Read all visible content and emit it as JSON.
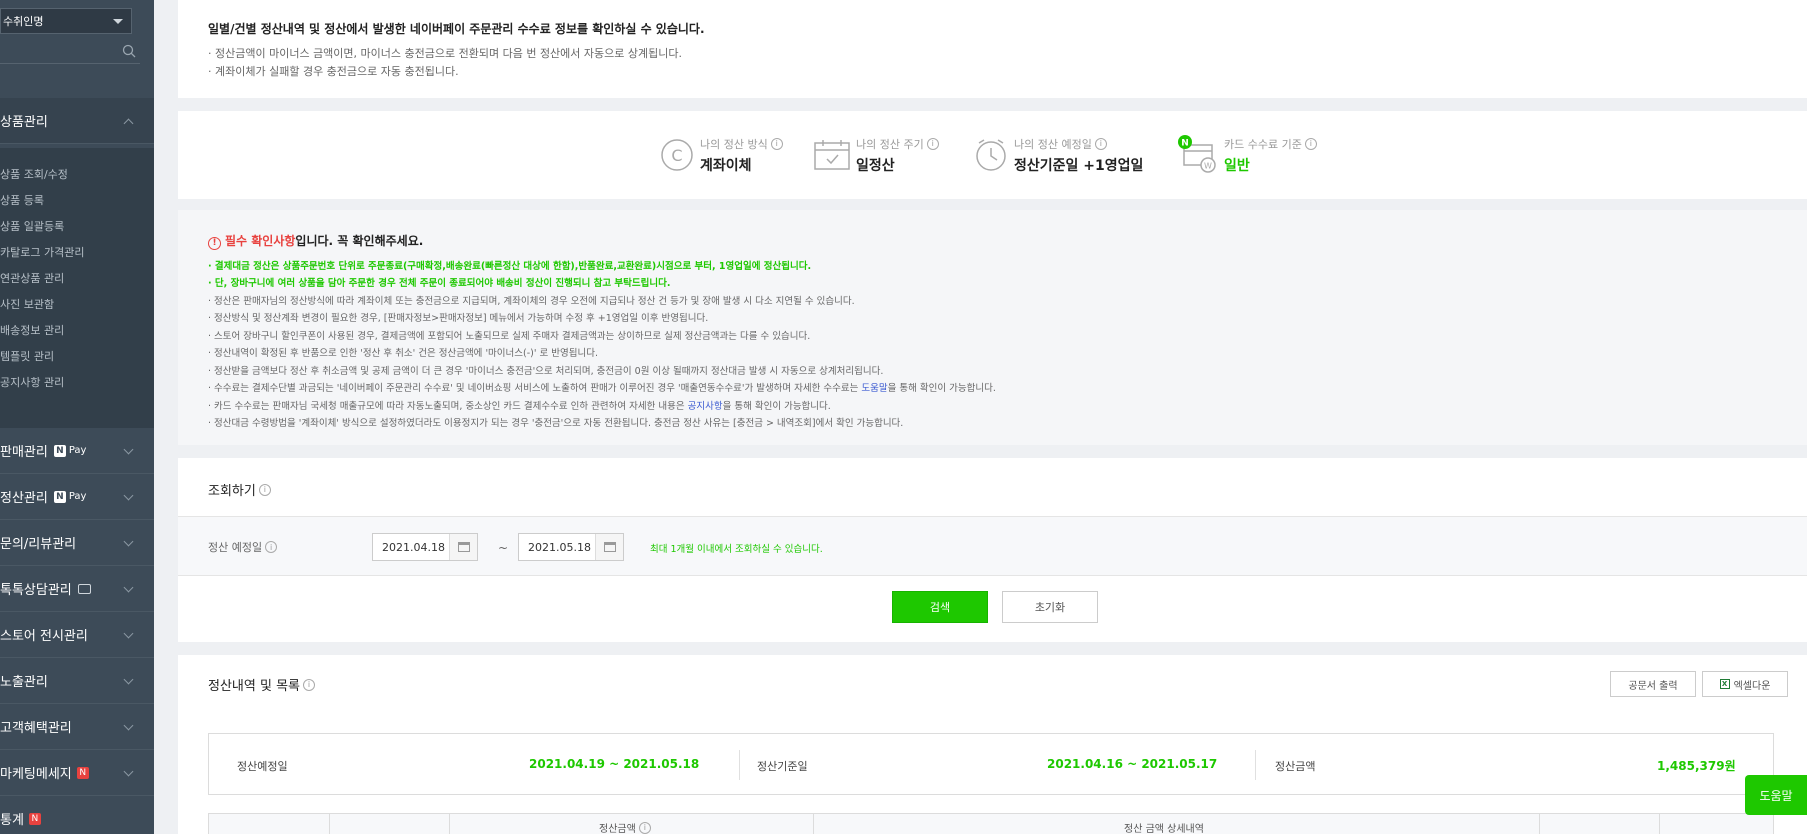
{
  "sidebar": {
    "store_select": "수취인명",
    "sections": {
      "product": "상품관리",
      "sales": "판매관리",
      "settlement": "정산관리",
      "inquiry": "문의/리뷰관리",
      "talktalk": "톡톡상담관리",
      "store_display": "스토어 전시관리",
      "exposure": "노출관리",
      "customer_benefit": "고객혜택관리",
      "marketing": "마케팅메세지",
      "stats": "통계"
    },
    "pay_badge": "Pay",
    "pay_n": "N",
    "new_badge": "N",
    "product_items": [
      "상품 조회/수정",
      "상품 등록",
      "상품 일괄등록",
      "카탈로그 가격관리",
      "연관상품 관리",
      "사진 보관함",
      "배송정보 관리",
      "템플릿 관리",
      "공지사항 관리"
    ]
  },
  "notice_top": {
    "title": "일별/건별 정산내역 및 정산에서 발생한 네이버페이 주문관리 수수료 정보를 확인하실 수 있습니다.",
    "lines": [
      "· 정산금액이 마이너스 금액이면, 마이너스 충전금으로 전환되며 다음 번 정산에서 자동으로 상계됩니다.",
      "· 계좌이체가 실패할 경우 충전금으로 자동 충전됩니다."
    ]
  },
  "settle_info": {
    "method": {
      "label": "나의 정산 방식",
      "value": "계좌이체",
      "icon_letter": "C"
    },
    "cycle": {
      "label": "나의 정산 주기",
      "value": "일정산"
    },
    "due": {
      "label": "나의 정산 예정일",
      "value": "정산기준일 +1영업일"
    },
    "card_fee": {
      "label": "카드 수수료 기준",
      "value": "일반",
      "badge": "N",
      "w": "W"
    },
    "help": "i"
  },
  "checklist": {
    "warn_icon": "!",
    "head_warn": "필수 확인사항",
    "head_rest": "입니다. 꼭 확인해주세요.",
    "items": [
      {
        "text": "· 결제대금 정산은 상품주문번호 단위로 주문종료(구매확정,배송완료(빠른정산 대상에 한함),반품완료,교환완료)시점으로 부터, 1영업일에 정산됩니다.",
        "green": true
      },
      {
        "text": "· 단, 장바구니에 여러 상품을 담아 주문한 경우 전체 주문이 종료되어야 배송비 정산이 진행되니 참고 부탁드립니다.",
        "green": true
      },
      {
        "text": "· 정산은 판매자님의 정산방식에 따라 계좌이체 또는 충전금으로 지급되며, 계좌이체의 경우 오전에 지급되나 정산 건 등가 및 장애 발생 시 다소 지연될 수 있습니다.",
        "green": false
      },
      {
        "text": "· 정산방식 및 정산계좌 변경이 필요한 경우, [판매자정보>판매자정보] 메뉴에서 가능하며 수정 후 +1영업일 이후 반영됩니다.",
        "green": false
      },
      {
        "text": "· 스토어 장바구니 할인쿠폰이 사용된 경우, 결제금액에 포함되어 노출되므로 실제 주매자 결제금액과는 상이하므로 실제 정산금액과는 다를 수 있습니다.",
        "green": false
      },
      {
        "text": "· 정산내역이 확정된 후 반품으로 인한 '정산 후 취소' 건은 정산금액에 '마이너스(-)' 로 반영됩니다.",
        "green": false
      },
      {
        "text": "· 정산받을 금액보다 정산 후 취소금액 및 공제 금액이 더 큰 경우 '마이너스 충전금'으로 처리되며, 충전금이 0원 이상 될때까지 정산대금 발생 시 자동으로 상계처리됩니다.",
        "green": false
      },
      {
        "text": "· 수수료는 결제수단별 과금되는 '네이버페이 주문관리 수수료' 및 네이버쇼핑 서비스에 노출하여 판매가 이루어진 경우 '매출연동수수료'가 발생하며 자세한 수수료는 ",
        "link": "도움말",
        "after": "을 통해 확인이 가능합니다.",
        "green": false
      },
      {
        "text": "· 카드 수수료는 판매자님 국세청 매출규모에 따라 자동노출되며, 중소상인 카드 결제수수료 인하 관련하여 자세한 내용은 ",
        "link": "공지사항",
        "after": "을 통해 확인이 가능합니다.",
        "green": false
      },
      {
        "text": "· 정산대금 수령방법을 '계좌이체' 방식으로 설정하였더라도 이용정지가 되는 경우 '충전금'으로 자동 전환됩니다. 충전금 정산 사유는 [충전금 > 내역조회]에서 확인 가능합니다.",
        "green": false
      }
    ]
  },
  "search": {
    "title": "조회하기",
    "date_label": "정산 예정일",
    "date_from": "2021.04.18",
    "tilde": "~",
    "date_to": "2021.05.18",
    "hint": "최대 1개월 이내에서 조회하실 수 있습니다.",
    "search_btn": "검색",
    "reset_btn": "초기화"
  },
  "list": {
    "title": "정산내역 및 목록",
    "print_btn": "공문서 출력",
    "excel_btn": "엑셀다운",
    "excel_x": "X",
    "summary": {
      "due_label": "정산예정일",
      "due_value": "2021.04.19 ~ 2021.05.18",
      "base_label": "정산기준일",
      "base_value": "2021.04.16 ~ 2021.05.17",
      "amount_label": "정산금액",
      "amount_value": "1,485,379원"
    },
    "table_headers": {
      "amount": "정산금액",
      "detail": "정산 금액 상세내역"
    }
  },
  "help_btn": "도움말",
  "colors": {
    "accent": "#1ec800",
    "sidebar": "#3d4b58",
    "warn": "#e8423f"
  }
}
